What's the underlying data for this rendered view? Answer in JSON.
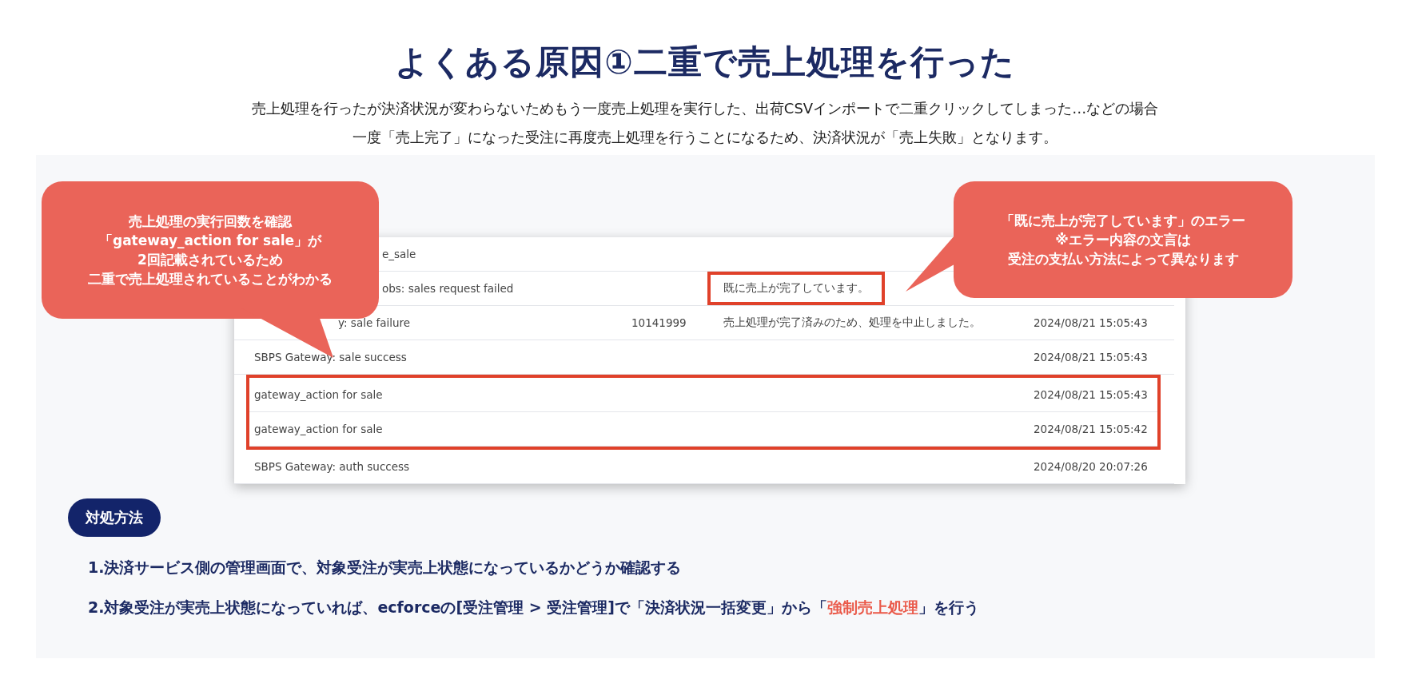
{
  "title": "よくある原因①二重で売上処理を行った",
  "intro": [
    "売上処理を行ったが決済状況が変わらないためもう一度売上処理を実行した、出荷CSVインポートで二重クリックしてしまった…などの場合",
    "一度「売上完了」になった受注に再度売上処理を行うことになるため、決済状況が「売上失敗」となります。"
  ],
  "log_rows": [
    {
      "kind": "covered",
      "event": "e_sale",
      "code": "",
      "message": "",
      "time": "",
      "highlighted": false,
      "message_highlighted": false
    },
    {
      "kind": "covered",
      "event": "obs: sales request failed",
      "code": "",
      "message": "既に売上が完了しています。",
      "time": "",
      "highlighted": false,
      "message_highlighted": true
    },
    {
      "kind": "partly-covered",
      "event": "y: sale failure",
      "code": "10141999",
      "message": "売上処理が完了済みのため、処理を中止しました。",
      "time": "2024/08/21 15:05:43",
      "highlighted": false,
      "message_highlighted": false
    },
    {
      "kind": "plain",
      "event": "SBPS Gateway: sale success",
      "code": "",
      "message": "",
      "time": "2024/08/21 15:05:43",
      "highlighted": false,
      "message_highlighted": false
    },
    {
      "kind": "plain",
      "event": "gateway_action for sale",
      "code": "",
      "message": "",
      "time": "2024/08/21 15:05:43",
      "highlighted": true,
      "message_highlighted": false
    },
    {
      "kind": "plain",
      "event": "gateway_action for sale",
      "code": "",
      "message": "",
      "time": "2024/08/21 15:05:42",
      "highlighted": true,
      "message_highlighted": false
    },
    {
      "kind": "plain",
      "event": "SBPS Gateway: auth success",
      "code": "",
      "message": "",
      "time": "2024/08/20 20:07:26",
      "highlighted": false,
      "message_highlighted": false
    }
  ],
  "callouts": [
    {
      "kind": "left",
      "lines": [
        "売上処理の実行回数を確認",
        "「gateway_action for sale」が",
        "2回記載されているため",
        "二重で売上処理されていることがわかる"
      ]
    },
    {
      "kind": "right",
      "lines": [
        "「既に売上が完了しています」のエラー",
        "※エラー内容の文言は",
        "受注の支払い方法によって異なります"
      ]
    }
  ],
  "solution": {
    "badge": "対処方法",
    "steps": [
      [
        {
          "kind": "plain",
          "text": "1.決済サービス側の管理画面で、対象受注が実売上状態になっているかどうか確認する"
        }
      ],
      [
        {
          "kind": "plain",
          "text": "2.対象受注が実売上状態になっていれば、ecforceの[受注管理 > 受注管理]で「決済状況一括変更」から「"
        },
        {
          "kind": "accent",
          "text": "強制売上処理"
        },
        {
          "kind": "plain",
          "text": "」を行う"
        }
      ]
    ]
  }
}
